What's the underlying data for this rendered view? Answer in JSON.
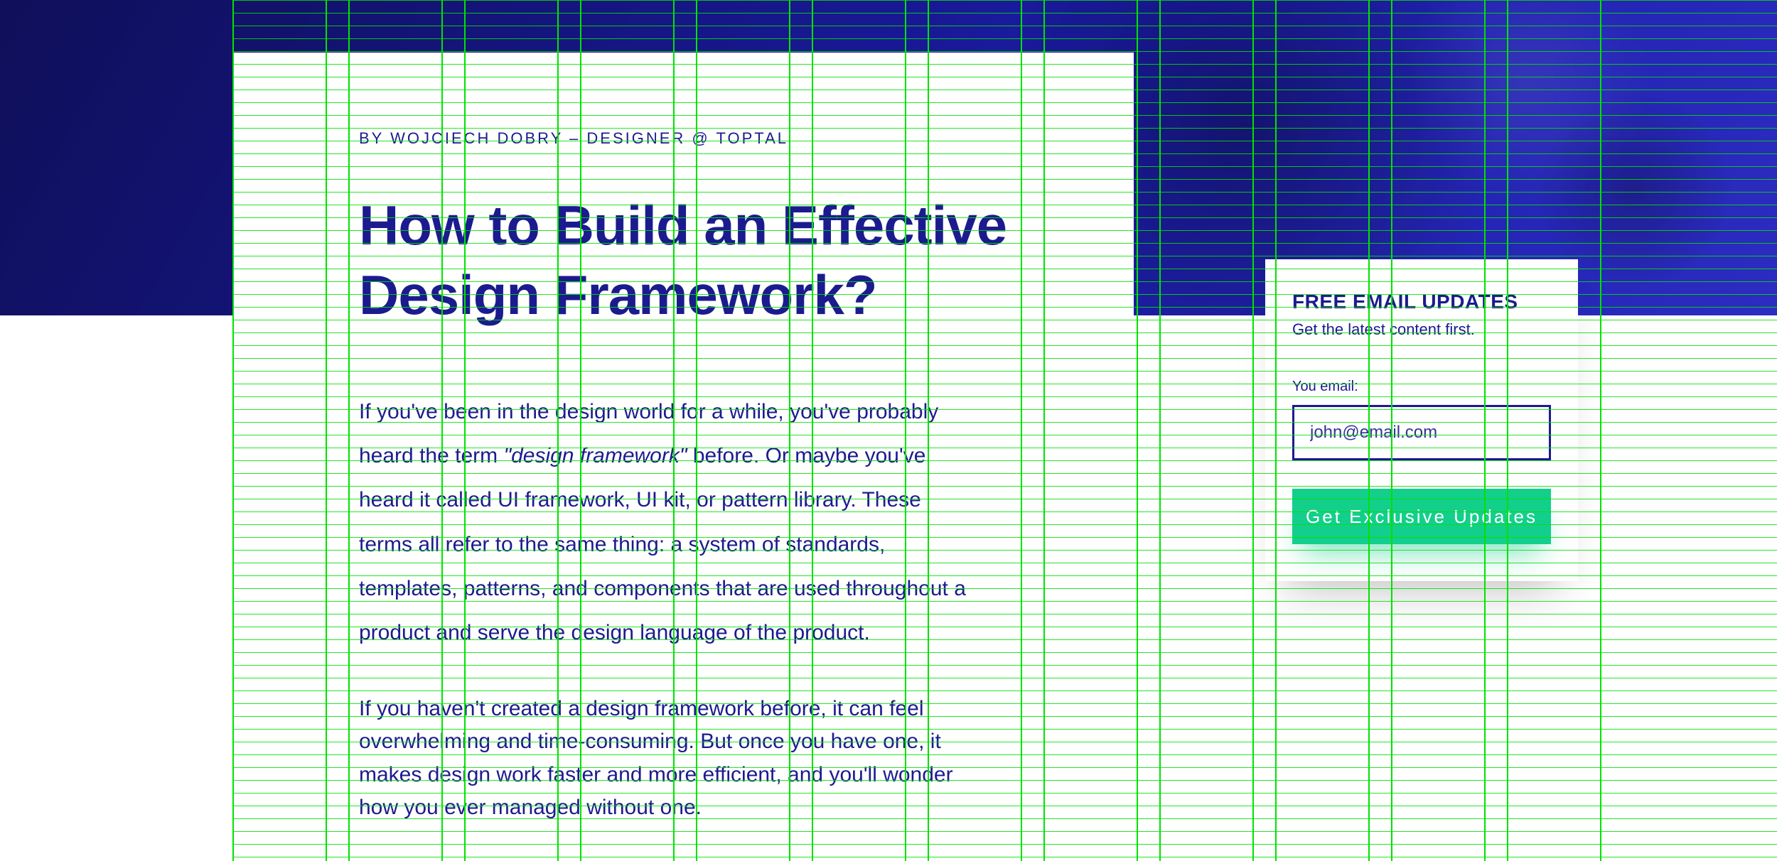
{
  "article": {
    "byline": "BY WOJCIECH DOBRY – DESIGNER @ TOPTAL",
    "title": "How to Build an Effective Design Framework?",
    "para1_pre": "If you've been in the design world for a while, you've probably heard the term ",
    "para1_em": "\"design framework\"",
    "para1_post": " before. Or maybe you've heard it called UI framework, UI kit, or pattern library. These terms all refer to the same thing: a system of standards, templates, patterns, and components that are used throughout a product and serve the design language of the product.",
    "para2": "If you haven't created a design framework before, it can feel overwhelming and time-consuming. But once you have one, it makes design work faster and more efficient, and you'll wonder how you ever managed without one."
  },
  "signup": {
    "title": "FREE EMAIL UPDATES",
    "subtitle": "Get the latest content first.",
    "email_label": "You email:",
    "email_placeholder": "john@email.com",
    "button_label": "Get Exclusive Updates"
  },
  "colors": {
    "brand_navy": "#1b1b8f",
    "grid_green": "#00e300",
    "cta_green": "#13cf8c"
  }
}
